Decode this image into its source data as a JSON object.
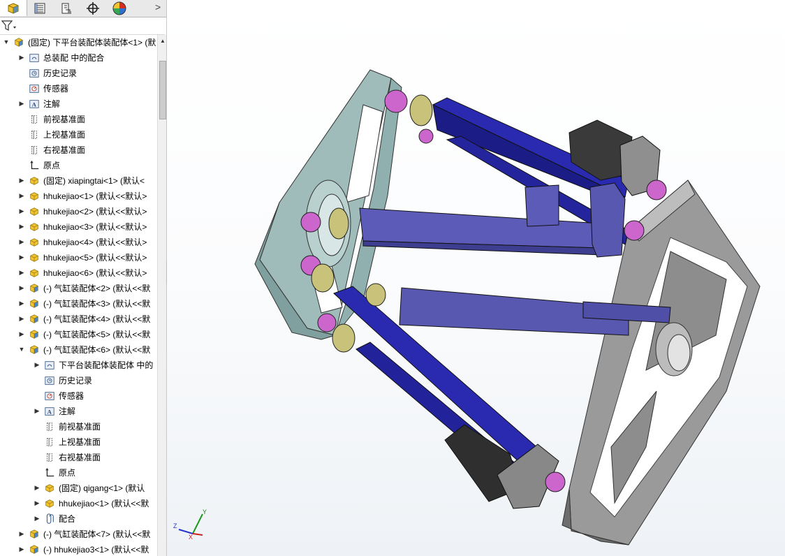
{
  "tabs": [
    {
      "name": "feature-manager",
      "icon": "feature-tree-icon"
    },
    {
      "name": "property-manager",
      "icon": "property-list-icon"
    },
    {
      "name": "configuration-manager",
      "icon": "configuration-icon"
    },
    {
      "name": "dimxpert-manager",
      "icon": "crosshair-icon"
    },
    {
      "name": "display-manager",
      "icon": "appearance-pie-icon"
    }
  ],
  "tabs_more_label": ">",
  "filter": {
    "icon": "funnel-icon"
  },
  "tree": [
    {
      "level": 0,
      "expander": "open",
      "icon": "assembly-icon",
      "label": "(固定) 下平台装配体装配体<1> (默"
    },
    {
      "level": 1,
      "expander": "closed",
      "icon": "mates-folder-icon",
      "label": "总装配 中的配合"
    },
    {
      "level": 1,
      "expander": "",
      "icon": "history-icon",
      "label": "历史记录"
    },
    {
      "level": 1,
      "expander": "",
      "icon": "sensor-icon",
      "label": "传感器"
    },
    {
      "level": 1,
      "expander": "closed",
      "icon": "annotation-icon",
      "label": "注解"
    },
    {
      "level": 1,
      "expander": "",
      "icon": "plane-icon",
      "label": "前视基准面"
    },
    {
      "level": 1,
      "expander": "",
      "icon": "plane-icon",
      "label": "上视基准面"
    },
    {
      "level": 1,
      "expander": "",
      "icon": "plane-icon",
      "label": "右视基准面"
    },
    {
      "level": 1,
      "expander": "",
      "icon": "origin-icon",
      "label": "原点"
    },
    {
      "level": 1,
      "expander": "closed",
      "icon": "part-icon",
      "label": "(固定) xiapingtai<1> (默认<"
    },
    {
      "level": 1,
      "expander": "closed",
      "icon": "part-icon",
      "label": "hhukejiao<1> (默认<<默认>"
    },
    {
      "level": 1,
      "expander": "closed",
      "icon": "part-icon",
      "label": "hhukejiao<2> (默认<<默认>"
    },
    {
      "level": 1,
      "expander": "closed",
      "icon": "part-icon",
      "label": "hhukejiao<3> (默认<<默认>"
    },
    {
      "level": 1,
      "expander": "closed",
      "icon": "part-icon",
      "label": "hhukejiao<4> (默认<<默认>"
    },
    {
      "level": 1,
      "expander": "closed",
      "icon": "part-icon",
      "label": "hhukejiao<5> (默认<<默认>"
    },
    {
      "level": 1,
      "expander": "closed",
      "icon": "part-icon",
      "label": "hhukejiao<6> (默认<<默认>"
    },
    {
      "level": 1,
      "expander": "closed",
      "icon": "assembly-icon",
      "label": "(-) 气缸装配体<2> (默认<<默"
    },
    {
      "level": 1,
      "expander": "closed",
      "icon": "assembly-icon",
      "label": "(-) 气缸装配体<3> (默认<<默"
    },
    {
      "level": 1,
      "expander": "closed",
      "icon": "assembly-icon",
      "label": "(-) 气缸装配体<4> (默认<<默"
    },
    {
      "level": 1,
      "expander": "closed",
      "icon": "assembly-icon",
      "label": "(-) 气缸装配体<5> (默认<<默"
    },
    {
      "level": 1,
      "expander": "open",
      "icon": "assembly-icon",
      "label": "(-) 气缸装配体<6> (默认<<默"
    },
    {
      "level": 2,
      "expander": "closed",
      "icon": "mates-folder-icon",
      "label": "下平台装配体装配体 中的"
    },
    {
      "level": 2,
      "expander": "",
      "icon": "history-icon",
      "label": "历史记录"
    },
    {
      "level": 2,
      "expander": "",
      "icon": "sensor-icon",
      "label": "传感器"
    },
    {
      "level": 2,
      "expander": "closed",
      "icon": "annotation-icon",
      "label": "注解"
    },
    {
      "level": 2,
      "expander": "",
      "icon": "plane-icon",
      "label": "前视基准面"
    },
    {
      "level": 2,
      "expander": "",
      "icon": "plane-icon",
      "label": "上视基准面"
    },
    {
      "level": 2,
      "expander": "",
      "icon": "plane-icon",
      "label": "右视基准面"
    },
    {
      "level": 2,
      "expander": "",
      "icon": "origin-icon",
      "label": "原点"
    },
    {
      "level": 2,
      "expander": "closed",
      "icon": "part-icon",
      "label": "(固定) qigang<1> (默认"
    },
    {
      "level": 2,
      "expander": "closed",
      "icon": "part-icon",
      "label": "hhukejiao<1> (默认<<默"
    },
    {
      "level": 2,
      "expander": "closed",
      "icon": "mates-icon",
      "label": "配合"
    },
    {
      "level": 1,
      "expander": "closed",
      "icon": "assembly-icon",
      "label": "(-) 气缸装配体<7> (默认<<默"
    },
    {
      "level": 1,
      "expander": "closed",
      "icon": "assembly-icon",
      "label": "(-) hhukejiao3<1> (默认<<默"
    }
  ],
  "triad": {
    "x_label": "X",
    "y_label": "Y",
    "z_label": "Z"
  },
  "colors": {
    "rod_blue": "#2a2ab0",
    "rod_blue_light": "#5c5cb8",
    "plate_teal": "#a8c4c2",
    "plate_gray": "#8e8e8e",
    "joint_pink": "#cc66cc",
    "bushing_tan": "#c8c27a",
    "motor_dark": "#3a3a3a"
  }
}
